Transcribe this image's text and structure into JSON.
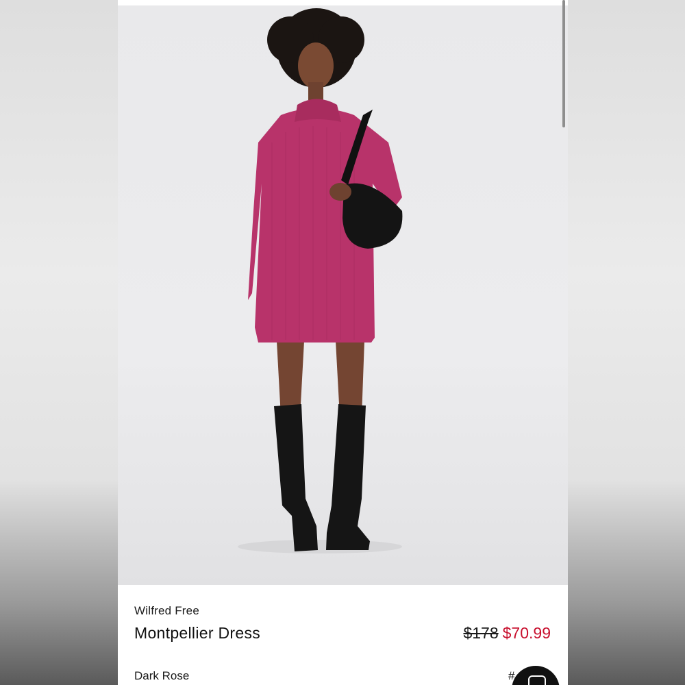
{
  "product": {
    "brand": "Wilfred Free",
    "name": "Montpellier Dress",
    "original_price": "$178",
    "sale_price": "$70.99",
    "color": "Dark Rose",
    "hash_label": "#"
  },
  "colors": {
    "sale_price": "#c8102e",
    "dress": "#b8336a",
    "photo_background": "#ececee"
  },
  "icons": {
    "chat": "chat-bubble-icon"
  }
}
